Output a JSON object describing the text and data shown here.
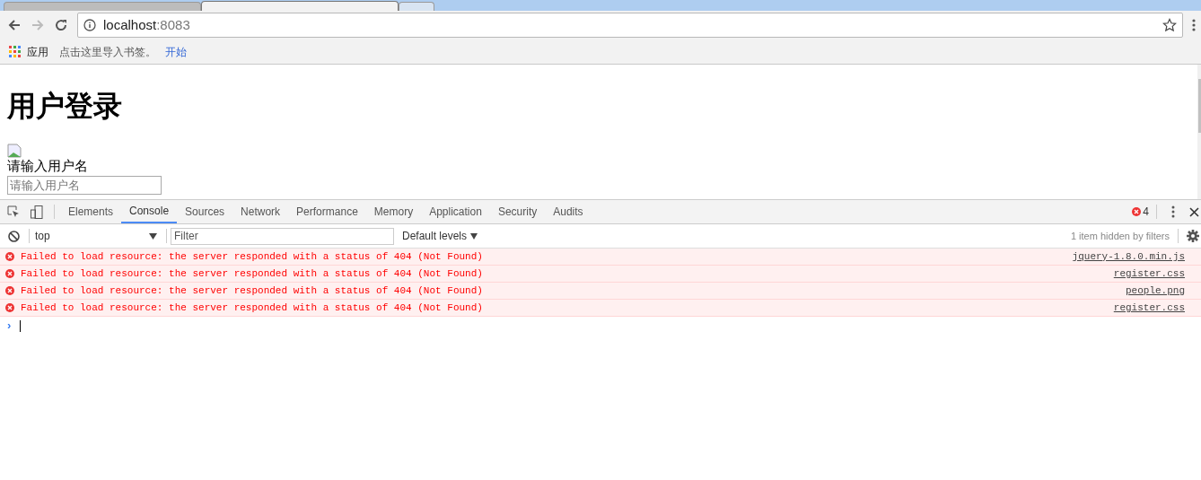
{
  "browser_tabs": [
    {
      "selected": false
    },
    {
      "selected": true
    },
    {
      "selected": false
    }
  ],
  "address_bar": {
    "host": "localhost",
    "port": ":8083"
  },
  "bookmarks_bar": {
    "apps": "应用",
    "hint": "点击这里导入书签。",
    "link": "开始"
  },
  "page": {
    "heading": "用户登录",
    "username_label": "请输入用户名",
    "username_placeholder": "请输入用户名"
  },
  "devtools": {
    "tabs": [
      {
        "label": "Elements",
        "selected": false
      },
      {
        "label": "Console",
        "selected": true
      },
      {
        "label": "Sources",
        "selected": false
      },
      {
        "label": "Network",
        "selected": false
      },
      {
        "label": "Performance",
        "selected": false
      },
      {
        "label": "Memory",
        "selected": false
      },
      {
        "label": "Application",
        "selected": false
      },
      {
        "label": "Security",
        "selected": false
      },
      {
        "label": "Audits",
        "selected": false
      }
    ],
    "error_count": "4",
    "context": "top",
    "filter_placeholder": "Filter",
    "levels": "Default levels",
    "hidden_note": "1 item hidden by filters",
    "messages": [
      {
        "text": "Failed to load resource: the server responded with a status of 404 (Not Found)",
        "source": "jquery-1.8.0.min.js"
      },
      {
        "text": "Failed to load resource: the server responded with a status of 404 (Not Found)",
        "source": "register.css"
      },
      {
        "text": "Failed to load resource: the server responded with a status of 404 (Not Found)",
        "source": "people.png"
      },
      {
        "text": "Failed to load resource: the server responded with a status of 404 (Not Found)",
        "source": "register.css"
      }
    ],
    "prompt": "›"
  }
}
